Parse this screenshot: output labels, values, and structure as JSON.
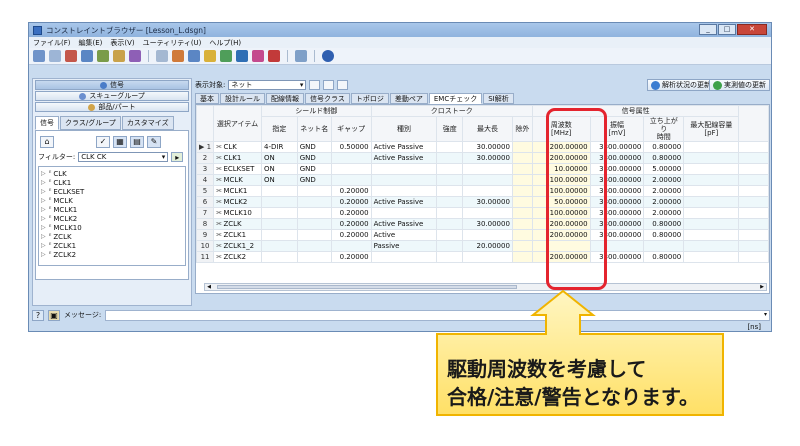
{
  "window": {
    "title": "コンストレイントブラウザー [Lesson_L.dsgn]",
    "min": "_",
    "max": "□",
    "close": "✕"
  },
  "menu": [
    "ファイル(F)",
    "編集(E)",
    "表示(V)",
    "ユーティリティ(U)",
    "ヘルプ(H)"
  ],
  "nav": {
    "signal": "信号",
    "skew_group": "スキューグループ",
    "parts": "部品/パート"
  },
  "left_tabs": [
    "信号",
    "クラス/グループ",
    "カスタマイズ"
  ],
  "filter": {
    "label": "フィルター:",
    "value": "CLK CK"
  },
  "tree_items": [
    "CLK",
    "CLK1",
    "ECLKSET",
    "MCLK",
    "MCLK1",
    "MCLK2",
    "MCLK10",
    "ZCLK",
    "ZCLK1",
    "ZCLK2"
  ],
  "target": {
    "label": "表示対象:",
    "value": "ネット"
  },
  "buttons": {
    "analysis_update": "解析状況の更新",
    "measured_update": "実測値の更新"
  },
  "main_tabs": [
    "基本",
    "設計ルール",
    "配線情報",
    "信号クラス",
    "トポロジ",
    "差動ペア",
    "EMCチェック",
    "SI解析"
  ],
  "active_main_tab": "EMCチェック",
  "grid": {
    "groups": {
      "shield": "シールド制御",
      "crosstalk": "クロストーク",
      "signal_attr": "信号属性"
    },
    "columns": {
      "select": "選択アイテム",
      "spec": "指定",
      "netname": "ネット名",
      "gap": "ギャップ",
      "kind": "種別",
      "strength": "強度",
      "maxlen": "最大長",
      "exclude": "除外",
      "freq": "周波数\n[MHz]",
      "amp": "振幅\n[mV]",
      "rise": "立ち上がり\n時間",
      "maxcap": "最大配線容量\n[pF]"
    },
    "rows": [
      {
        "n": "1",
        "item": "CLK",
        "spec": "4-DIR",
        "net": "GND",
        "gap": "0.50000",
        "kind": "Active Passive",
        "strength": "",
        "maxlen": "30.00000",
        "freq": "200.00000",
        "amp": "3300.00000",
        "rise": "0.80000"
      },
      {
        "n": "2",
        "item": "CLK1",
        "spec": "ON",
        "net": "GND",
        "gap": "",
        "kind": "Active Passive",
        "strength": "",
        "maxlen": "30.00000",
        "freq": "200.00000",
        "amp": "3300.00000",
        "rise": "0.80000"
      },
      {
        "n": "3",
        "item": "ECLKSET",
        "spec": "ON",
        "net": "GND",
        "gap": "",
        "kind": "",
        "strength": "",
        "maxlen": "",
        "freq": "10.00000",
        "amp": "3300.00000",
        "rise": "5.00000"
      },
      {
        "n": "4",
        "item": "MCLK",
        "spec": "ON",
        "net": "GND",
        "gap": "",
        "kind": "",
        "strength": "",
        "maxlen": "",
        "freq": "100.00000",
        "amp": "3300.00000",
        "rise": "2.00000"
      },
      {
        "n": "5",
        "item": "MCLK1",
        "spec": "",
        "net": "",
        "gap": "0.20000",
        "kind": "",
        "strength": "",
        "maxlen": "",
        "freq": "100.00000",
        "amp": "3300.00000",
        "rise": "2.00000"
      },
      {
        "n": "6",
        "item": "MCLK2",
        "spec": "",
        "net": "",
        "gap": "0.20000",
        "kind": "Active Passive",
        "strength": "",
        "maxlen": "30.00000",
        "freq": "50.00000",
        "amp": "3300.00000",
        "rise": "2.00000"
      },
      {
        "n": "7",
        "item": "MCLK10",
        "spec": "",
        "net": "",
        "gap": "0.20000",
        "kind": "",
        "strength": "",
        "maxlen": "",
        "freq": "100.00000",
        "amp": "3300.00000",
        "rise": "2.00000"
      },
      {
        "n": "8",
        "item": "ZCLK",
        "spec": "",
        "net": "",
        "gap": "0.20000",
        "kind": "Active Passive",
        "strength": "",
        "maxlen": "30.00000",
        "freq": "200.00000",
        "amp": "3300.00000",
        "rise": "0.80000"
      },
      {
        "n": "9",
        "item": "ZCLK1",
        "spec": "",
        "net": "",
        "gap": "0.20000",
        "kind": "Active",
        "strength": "",
        "maxlen": "",
        "freq": "200.00000",
        "amp": "3300.00000",
        "rise": "0.80000"
      },
      {
        "n": "10",
        "item": "ZCLK1_2",
        "spec": "",
        "net": "",
        "gap": "",
        "kind": "Passive",
        "strength": "",
        "maxlen": "20.00000",
        "freq": "",
        "amp": "",
        "rise": ""
      },
      {
        "n": "11",
        "item": "ZCLK2",
        "spec": "",
        "net": "",
        "gap": "0.20000",
        "kind": "",
        "strength": "",
        "maxlen": "",
        "freq": "200.00000",
        "amp": "3300.00000",
        "rise": "0.80000"
      }
    ]
  },
  "message_label": "メッセージ:",
  "unit": "[ns]",
  "callout": {
    "line1": "駆動周波数を考慮して",
    "line2": "合格/注意/警告となります。"
  }
}
